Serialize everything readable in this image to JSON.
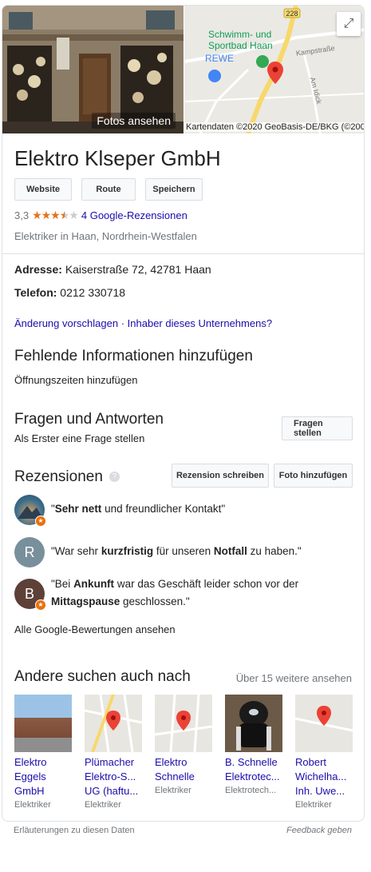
{
  "hero": {
    "photos_label": "Fotos ansehen",
    "map_attribution": "Kartendaten ©2020 GeoBasis-DE/BKG (©2009)",
    "map_labels": {
      "pool": "Schwimm- und\nSportbad Haan",
      "store": "REWE",
      "road_number": "228",
      "street1": "Kampstraße",
      "street2": "Am Idick"
    }
  },
  "business": {
    "name": "Elektro Klseper GmbH",
    "buttons": {
      "website": "Website",
      "route": "Route",
      "save": "Speichern"
    },
    "rating": "3,3",
    "rating_value": 3.3,
    "reviews_link": "4 Google-Rezensionen",
    "category": "Elektriker in Haan, Nordrhein-Westfalen"
  },
  "details": {
    "address_label": "Adresse:",
    "address_value": "Kaiserstraße 72, 42781 Haan",
    "phone_label": "Telefon:",
    "phone_value": "0212 330718",
    "suggest_edit": "Änderung vorschlagen",
    "separator": " · ",
    "owner_link": "Inhaber dieses Unternehmens?"
  },
  "missing_info": {
    "heading": "Fehlende Informationen hinzufügen",
    "add_hours": "Öffnungszeiten hinzufügen"
  },
  "qa": {
    "heading": "Fragen und Antworten",
    "first_question": "Als Erster eine Frage stellen",
    "ask_button": "Fragen stellen"
  },
  "reviews": {
    "heading": "Rezensionen",
    "help_icon": "?",
    "write_button": "Rezension schreiben",
    "photo_button": "Foto hinzufügen",
    "items": [
      {
        "initial": "",
        "open": "\"",
        "b1": "Sehr nett",
        "t1": " und freundlicher Kontakt\"",
        "b2": "",
        "t2": "",
        "color": "#3d6f8e"
      },
      {
        "initial": "R",
        "open": "\"War sehr ",
        "b1": "kurzfristig",
        "t1": " für unseren ",
        "b2": "Notfall",
        "t2": " zu haben.\"",
        "color": "#78909c"
      },
      {
        "initial": "B",
        "open": "\"Bei ",
        "b1": "Ankunft",
        "t1": " war das Geschäft leider schon vor der ",
        "b2": "Mittagspause",
        "t2": " geschlossen.\"",
        "color": "#5d4037"
      }
    ],
    "all_link": "Alle Google-Bewertungen ansehen"
  },
  "others": {
    "heading": "Andere suchen auch nach",
    "more": "Über 15 weitere ansehen",
    "items": [
      {
        "name": "Elektro\nEggels\nGmbH",
        "type": "Elektriker"
      },
      {
        "name": "Plümacher\nElektro-S...\nUG (haftu...",
        "type": "Elektriker"
      },
      {
        "name": "Elektro\nSchnelle",
        "type": "Elektriker"
      },
      {
        "name": "B. Schnelle\nElektrotec...",
        "type": "Elektrotech..."
      },
      {
        "name": "Robert\nWichelha...\nInh. Uwe...",
        "type": "Elektriker"
      }
    ]
  },
  "footer": {
    "explanations": "Erläuterungen zu diesen Daten",
    "feedback": "Feedback geben"
  },
  "colors": {
    "link": "#1a0dab",
    "star": "#e7711b",
    "pin": "#ea4335"
  }
}
